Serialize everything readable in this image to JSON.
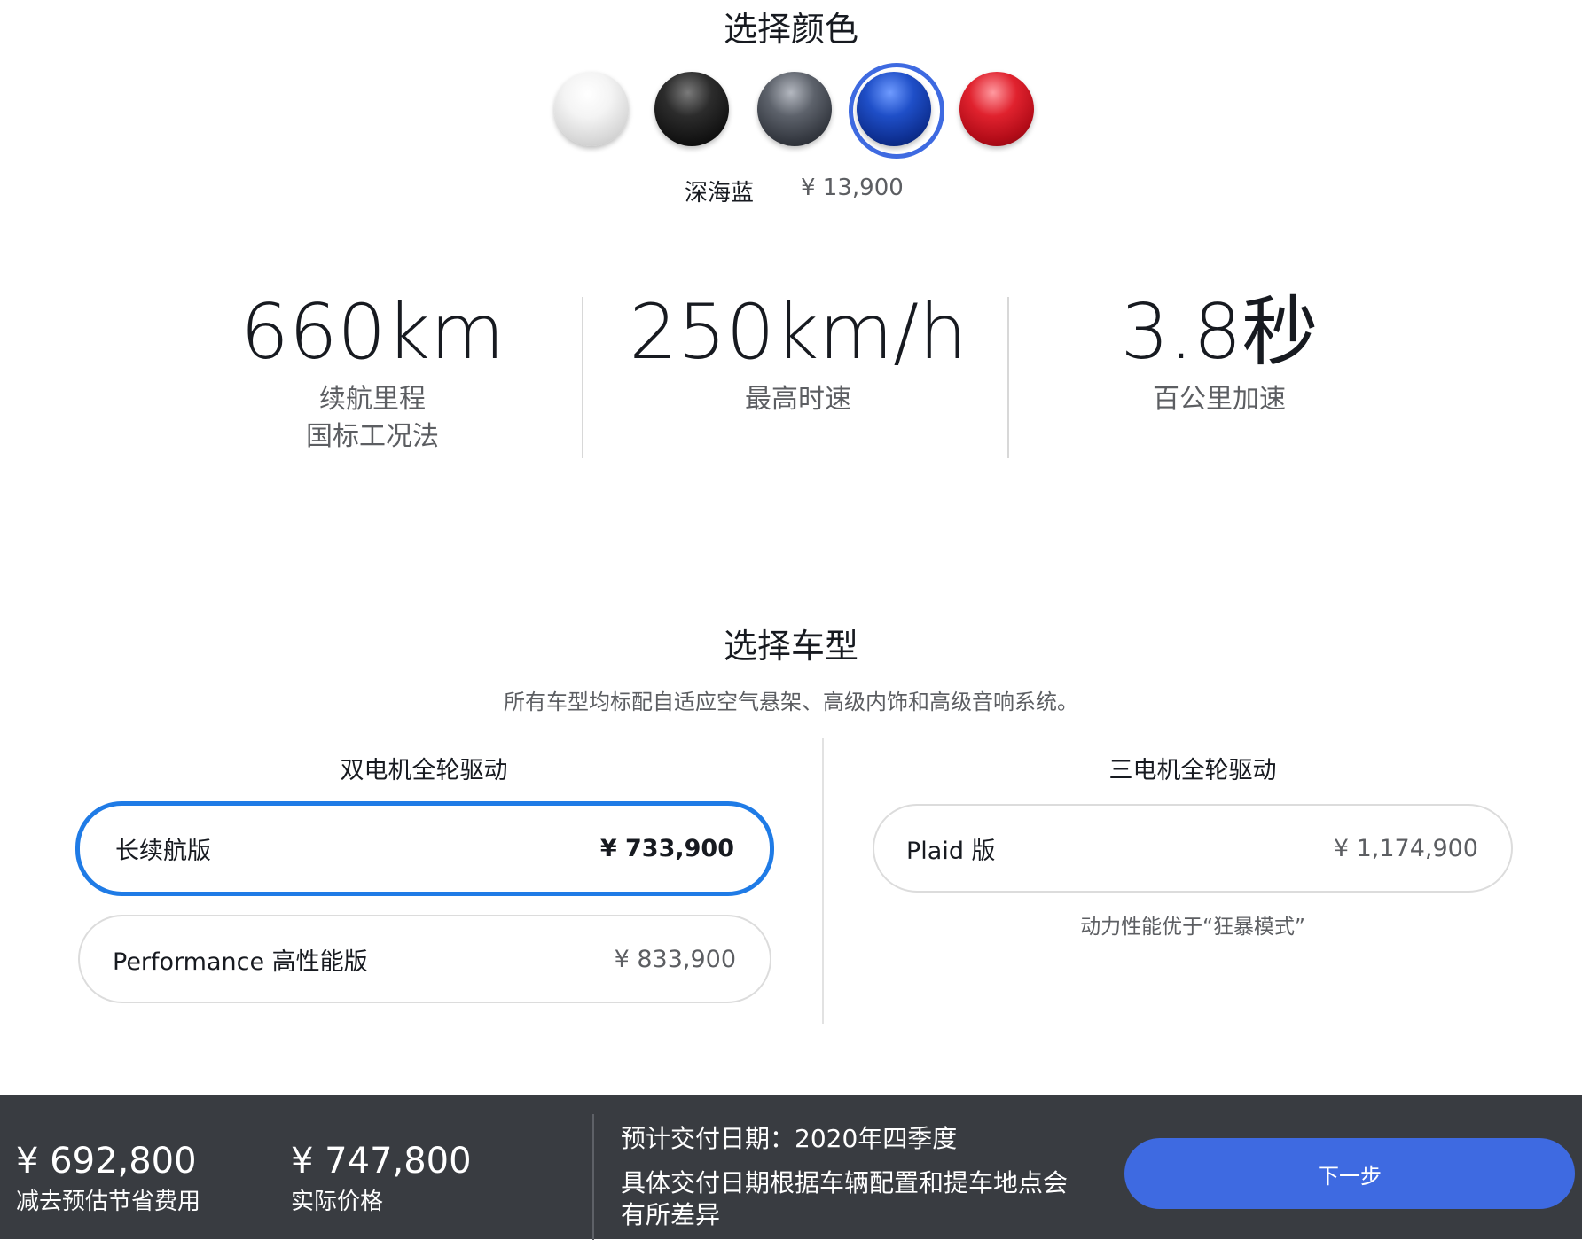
{
  "color_section": {
    "title": "选择颜色",
    "swatches": [
      {
        "name": "white-paint",
        "color": "#f2f2f2"
      },
      {
        "name": "black-paint",
        "color": "#1a1a1a"
      },
      {
        "name": "gray-paint",
        "color": "#3b3f46"
      },
      {
        "name": "blue-paint",
        "color": "#0e3093",
        "selected": true
      },
      {
        "name": "red-paint",
        "color": "#c4121d"
      }
    ],
    "selected_name": "深海蓝",
    "selected_price": "¥ 13,900"
  },
  "specs": [
    {
      "value": "660km",
      "label": "续航里程",
      "sublabel": "国标工况法"
    },
    {
      "value": "250km/h",
      "label": "最高时速"
    },
    {
      "value": "3.8秒",
      "label": "百公里加速"
    }
  ],
  "model_section": {
    "title": "选择车型",
    "subtitle": "所有车型均标配自适应空气悬架、高级内饰和高级音响系统。",
    "dual_motor": {
      "heading": "双电机全轮驱动",
      "options": [
        {
          "label": "长续航版",
          "price": "¥ 733,900",
          "selected": true
        },
        {
          "label": "Performance 高性能版",
          "price": "¥ 833,900"
        }
      ]
    },
    "tri_motor": {
      "heading": "三电机全轮驱动",
      "options": [
        {
          "label": "Plaid 版",
          "price": "¥ 1,174,900"
        }
      ],
      "note": "动力性能优于“狂暴模式”"
    }
  },
  "footer": {
    "savings_price": "¥ 692,800",
    "savings_label": "减去预估节省费用",
    "actual_price": "¥ 747,800",
    "actual_label": "实际价格",
    "delivery": "预计交付日期：2020年四季度",
    "delivery_note": "具体交付日期根据车辆配置和提车地点会有所差异",
    "next_button": "下一步"
  },
  "colors": {
    "accent_blue": "#3e6ae1",
    "selected_border": "#1f7be6",
    "footer_bg": "#393c41"
  }
}
